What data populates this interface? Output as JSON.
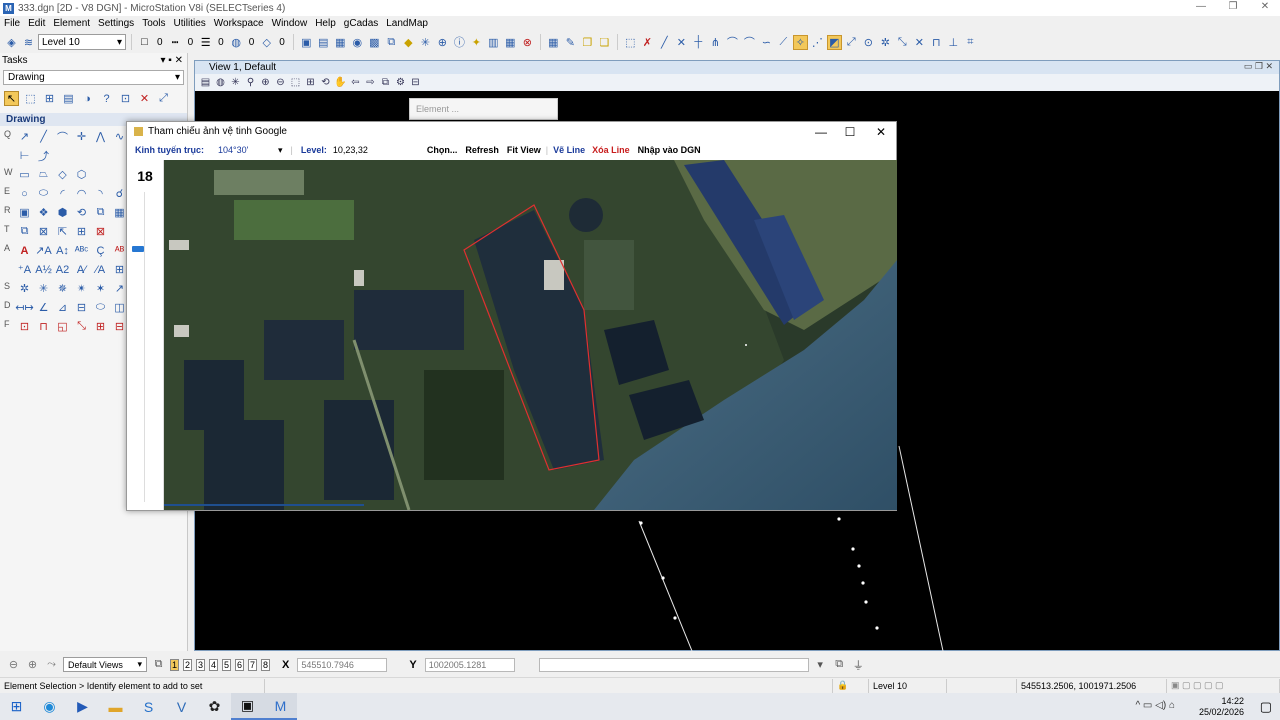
{
  "window": {
    "title": "333.dgn [2D - V8 DGN] - MicroStation V8i (SELECTseries 4)",
    "min": "—",
    "max": "❐",
    "close": "✕"
  },
  "menu": [
    "File",
    "Edit",
    "Element",
    "Settings",
    "Tools",
    "Utilities",
    "Workspace",
    "Window",
    "Help",
    "gCadas",
    "LandMap"
  ],
  "toolbar": {
    "level": "Level 10",
    "color_value": "0",
    "style_value": "0",
    "weight_value": "0",
    "transparency_value": "0",
    "priority_value": "0"
  },
  "tasks": {
    "title": "Tasks",
    "combo": "Drawing",
    "section": "Drawing",
    "row_labels": [
      "Q",
      "",
      "W",
      "E",
      "R",
      "T",
      "A",
      "",
      "S",
      "D",
      "F"
    ]
  },
  "view": {
    "title": "View 1, Default"
  },
  "element_dialog": {
    "title": "Element ..."
  },
  "sat_dialog": {
    "title": "Tham chiếu ảnh vệ tinh Google",
    "kinh_label": "Kinh tuyến trục:",
    "kinh_value": "104°30'",
    "level_label": "Level:",
    "level_value": "10,23,32",
    "chon": "Chọn...",
    "refresh": "Refresh",
    "fit_view": "Fit View",
    "ve_line": "Vẽ Line",
    "xoa_line": "Xóa Line",
    "nhap_dgn": "Nhập vào DGN",
    "zoom_level": "18",
    "zoom_slider_position": 0.18
  },
  "viewbar": {
    "views_combo": "Default Views",
    "view_numbers": [
      "1",
      "2",
      "3",
      "4",
      "5",
      "6",
      "7",
      "8"
    ],
    "x_label": "X",
    "x_value": "545510.7946",
    "y_label": "Y",
    "y_value": "1002005.1281"
  },
  "status": {
    "prompt": "Element Selection > Identify element to add to set",
    "level": "Level 10",
    "coords": "545513.2506, 1001971.2506"
  },
  "taskbar": {
    "time": "14:22",
    "date": "25/02/2026"
  }
}
